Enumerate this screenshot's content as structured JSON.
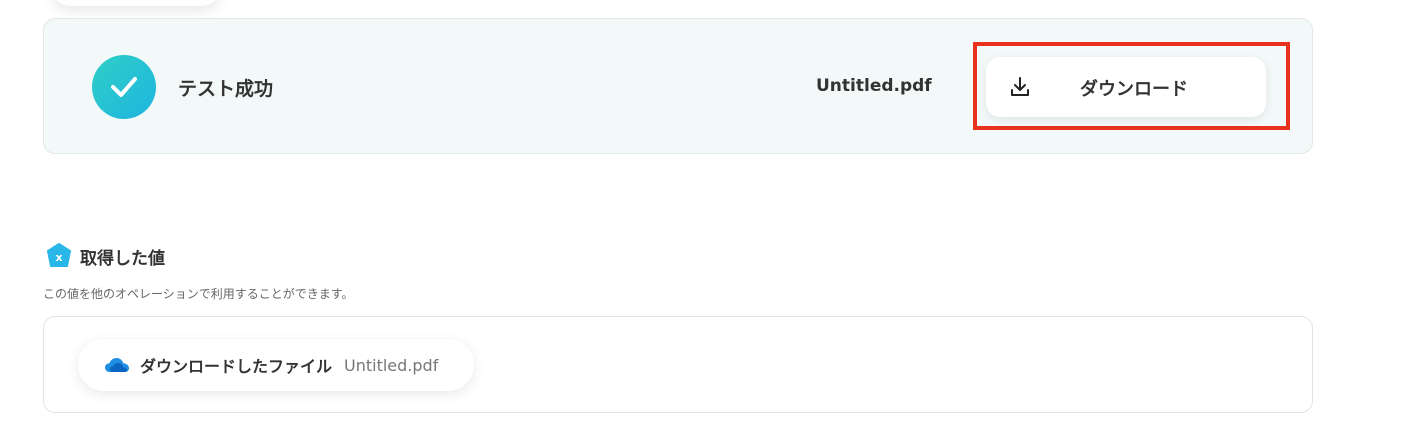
{
  "result": {
    "status_text": "テスト成功",
    "file_name": "Untitled.pdf",
    "download_label": "ダウンロード"
  },
  "retrieved": {
    "title": "取得した値",
    "description": "この値を他のオペレーションで利用することができます。",
    "items": [
      {
        "label": "ダウンロードしたファイル",
        "value": "Untitled.pdf",
        "icon": "onedrive-cloud-icon"
      }
    ]
  },
  "colors": {
    "check_gradient_start": "#2fd0c6",
    "check_gradient_end": "#1fb4e0",
    "highlight_border": "#e8321e",
    "section_icon": "#29b6e8",
    "onedrive_blue": "#0a66c2"
  }
}
